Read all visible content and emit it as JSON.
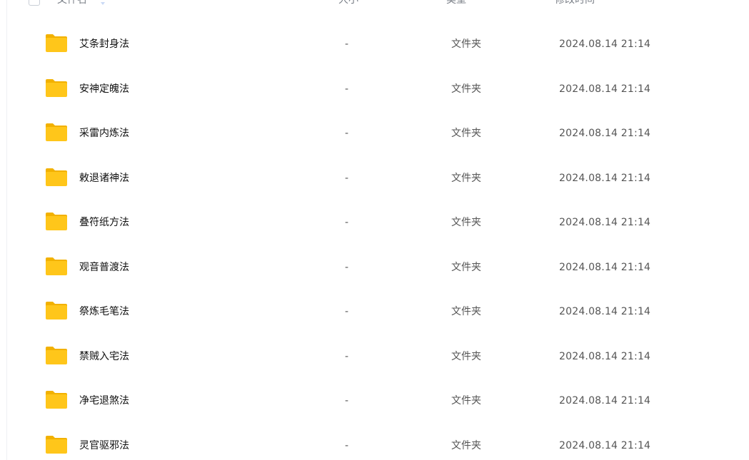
{
  "header": {
    "name_label": "文件名",
    "size_label": "大小",
    "type_label": "类型",
    "mtime_label": "修改时间"
  },
  "files": [
    {
      "name": "艾条封身法",
      "size": "-",
      "type": "文件夹",
      "mtime": "2024.08.14 21:14"
    },
    {
      "name": "安神定魄法",
      "size": "-",
      "type": "文件夹",
      "mtime": "2024.08.14 21:14"
    },
    {
      "name": "采雷内炼法",
      "size": "-",
      "type": "文件夹",
      "mtime": "2024.08.14 21:14"
    },
    {
      "name": "敕退诸神法",
      "size": "-",
      "type": "文件夹",
      "mtime": "2024.08.14 21:14"
    },
    {
      "name": "叠符纸方法",
      "size": "-",
      "type": "文件夹",
      "mtime": "2024.08.14 21:14"
    },
    {
      "name": "观音普渡法",
      "size": "-",
      "type": "文件夹",
      "mtime": "2024.08.14 21:14"
    },
    {
      "name": "祭炼毛笔法",
      "size": "-",
      "type": "文件夹",
      "mtime": "2024.08.14 21:14"
    },
    {
      "name": "禁贼入宅法",
      "size": "-",
      "type": "文件夹",
      "mtime": "2024.08.14 21:14"
    },
    {
      "name": "净宅退煞法",
      "size": "-",
      "type": "文件夹",
      "mtime": "2024.08.14 21:14"
    },
    {
      "name": "灵官驱邪法",
      "size": "-",
      "type": "文件夹",
      "mtime": "2024.08.14 21:14"
    }
  ],
  "colors": {
    "folder": "#ffc61a",
    "folder_dark": "#f2b100",
    "sort_active": "#3a8bff"
  }
}
